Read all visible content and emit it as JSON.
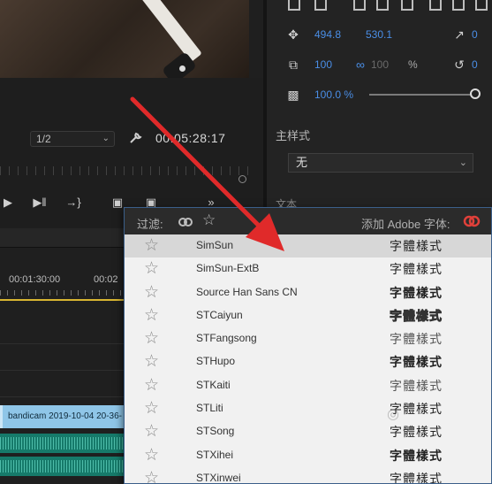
{
  "monitor": {
    "resolution": "1/2",
    "timecode": "00:05:28:17"
  },
  "transport": {
    "play_icon": "play-icon",
    "step_icon": "step-forward-icon",
    "goto_icon": "go-to-out-icon",
    "export_icon": "export-frame-icon",
    "overflow_label": "»"
  },
  "properties": {
    "position_x": "494.8",
    "position_y": "530.1",
    "scale": "100",
    "scale_locked": "100",
    "scale_unit": "%",
    "opacity": "100.0 %",
    "opacity_level": 1.0,
    "master_style_label": "主样式",
    "master_style_value": "无",
    "text_section_label": "文本"
  },
  "timeline": {
    "time_1": "00:01:30:00",
    "time_2": "00:02",
    "clip_name": "bandicam 2019-10-04 20-36-"
  },
  "font_menu": {
    "filter_label": "过滤:",
    "add_fonts_label": "添加 Adobe 字体:",
    "selected_index": 0,
    "fonts": [
      {
        "name": "SimSun",
        "sample": "字體樣式"
      },
      {
        "name": "SimSun-ExtB",
        "sample": "字體樣式"
      },
      {
        "name": "Source Han Sans CN",
        "sample": "字體樣式"
      },
      {
        "name": "STCaiyun",
        "sample": "字體樣式"
      },
      {
        "name": "STFangsong",
        "sample": "字體樣式"
      },
      {
        "name": "STHupo",
        "sample": "字體樣式"
      },
      {
        "name": "STKaiti",
        "sample": "字體樣式"
      },
      {
        "name": "STLiti",
        "sample": "字體樣式"
      },
      {
        "name": "STSong",
        "sample": "字體樣式"
      },
      {
        "name": "STXihei",
        "sample": "字體樣式"
      },
      {
        "name": "STXinwei",
        "sample": "字體樣式"
      }
    ]
  },
  "colors": {
    "accent_blue": "#4a8ee6",
    "arrow_red": "#e02a2a",
    "clip_blue": "#8fc6e8",
    "audio_green": "#167a6a",
    "playhead_yellow": "#d8b531"
  }
}
